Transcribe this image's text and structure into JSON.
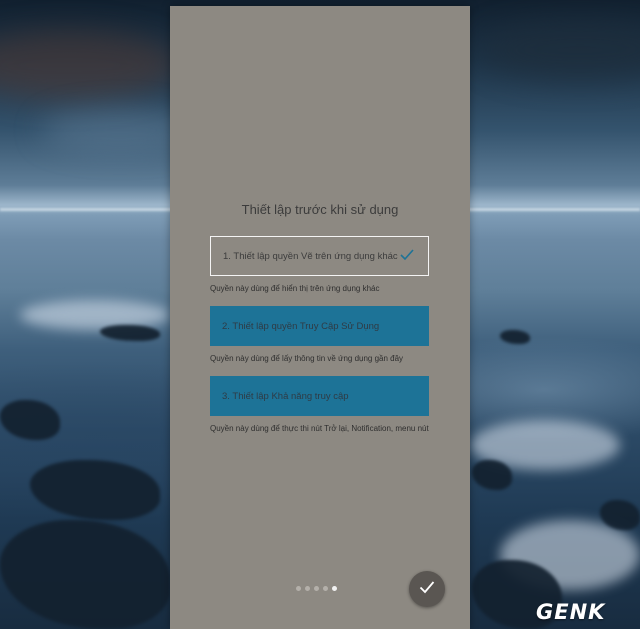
{
  "dialog": {
    "title": "Thiết lập trước khi sử dụng",
    "options": [
      {
        "label": "1. Thiết lập quyền Vẽ trên ứng dụng khác",
        "description": "Quyền này dùng để hiển thị trên ứng dụng khác",
        "completed": true
      },
      {
        "label": "2. Thiết lập quyền Truy Cập Sử Dụng",
        "description": "Quyền này dùng để lấy thông tin về ứng dụng gần đây",
        "completed": false
      },
      {
        "label": "3. Thiết lập Khả năng truy cập",
        "description": "Quyền này dùng để thực thi nút Trở lại, Notification, menu nút",
        "completed": false
      }
    ],
    "page_indicator": {
      "total": 5,
      "current": 5
    },
    "confirm_icon": "check-icon"
  },
  "watermark": {
    "text": "GENK"
  },
  "colors": {
    "card_background": "#8d8982",
    "option_active": "#1d7397",
    "option_border": "#f4f4f4",
    "fab_background": "#5a5652"
  }
}
